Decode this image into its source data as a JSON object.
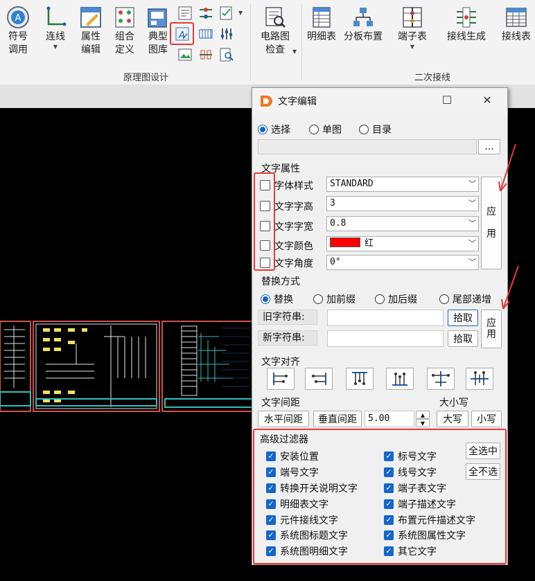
{
  "ribbon": {
    "buttons": [
      {
        "id": "symbol-call",
        "label": "符号\n调用"
      },
      {
        "id": "connect",
        "label": "连线"
      },
      {
        "id": "attr-edit",
        "label": "属性\n编辑"
      },
      {
        "id": "combo-define",
        "label": "组合\n定义"
      },
      {
        "id": "typical-lib",
        "label": "典型\n图库"
      },
      {
        "id": "circuit-check",
        "label": "电路图\n检查"
      },
      {
        "id": "detail-table",
        "label": "明细表"
      },
      {
        "id": "cabinet-layout",
        "label": "分板布置"
      },
      {
        "id": "terminal-table",
        "label": "端子表"
      },
      {
        "id": "wiring-gen",
        "label": "接线生成"
      },
      {
        "id": "wiring-table",
        "label": "接线表"
      }
    ],
    "groups": {
      "schematic": "原理图设计",
      "secondary": "二次接线"
    }
  },
  "dialog": {
    "title": "文字编辑",
    "select_mode": {
      "options": [
        "选择",
        "单图",
        "目录"
      ],
      "selected": "选择"
    },
    "browse_label": "...",
    "text_attrs": {
      "heading": "文字属性",
      "rows": [
        {
          "label": "字体样式",
          "value": "STANDARD"
        },
        {
          "label": "文字字高",
          "value": "3"
        },
        {
          "label": "文字字宽",
          "value": "0.8"
        },
        {
          "label": "文字颜色",
          "value": "红",
          "swatch": "#ff0000"
        },
        {
          "label": "文字角度",
          "value": "0°"
        }
      ],
      "apply_label": "应\n\n用"
    },
    "replace": {
      "heading": "替换方式",
      "options": [
        "替换",
        "加前缀",
        "加后缀",
        "尾部递增"
      ],
      "selected": "替换",
      "old_label": "旧字符串:",
      "new_label": "新字符串:",
      "pick_label": "拾取",
      "apply_label": "应\n用"
    },
    "align": {
      "heading": "文字对齐",
      "icons": [
        "align-left-icon",
        "align-right-icon",
        "align-top-icon",
        "align-bottom-icon",
        "align-hcenter-icon",
        "align-vcenter-icon"
      ]
    },
    "spacing": {
      "heading": "文字间距",
      "h_label": "水平间距",
      "v_label": "垂直间距",
      "value": "5.00"
    },
    "case": {
      "heading": "大小写",
      "upper": "大写",
      "lower": "小写"
    },
    "filter": {
      "heading": "高级过滤器",
      "select_all": "全选中",
      "select_none": "全不选",
      "left": [
        "安装位置",
        "端号文字",
        "转换开关说明文字",
        "明细表文字",
        "元件接线文字",
        "系统图标题文字",
        "系统图明细文字"
      ],
      "right": [
        "标号文字",
        "线号文字",
        "端子表文字",
        "端子描述文字",
        "布置元件描述文字",
        "系统图属性文字",
        "其它文字"
      ]
    }
  },
  "colors": {
    "accent": "#1466c8",
    "highlight": "#e53935"
  }
}
